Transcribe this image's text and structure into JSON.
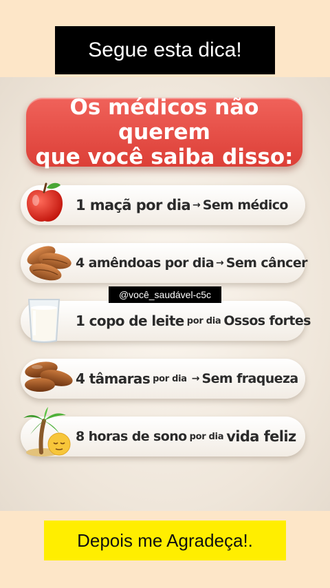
{
  "top_banner": {
    "text": "Segue esta dica!"
  },
  "headline": {
    "line1": "Os médicos não querem",
    "line2": "que você saiba disso:"
  },
  "watermark": {
    "text": "@você_saudável-c5c"
  },
  "arrow_glyph": "→",
  "tips": [
    {
      "icon": "apple-icon",
      "part1": "1 maçã por dia",
      "arrow": true,
      "part2": "Sem médico"
    },
    {
      "icon": "almonds-icon",
      "part1": "4 amêndoas por dia",
      "arrow": true,
      "part2": "Sem câncer"
    },
    {
      "icon": "milk-glass-icon",
      "part1": "1 copo de leite",
      "small": "por dia",
      "part2": "Ossos fortes"
    },
    {
      "icon": "dates-icon",
      "part1": "4 tâmaras",
      "small": "por dia",
      "arrow": true,
      "part2": "Sem fraqueza"
    },
    {
      "icon": "palm-tree-icon",
      "part1": "8 horas de sono",
      "small": "por dia",
      "part2": "vida feliz"
    }
  ],
  "bottom_banner": {
    "text": "Depois me Agradeça!."
  }
}
